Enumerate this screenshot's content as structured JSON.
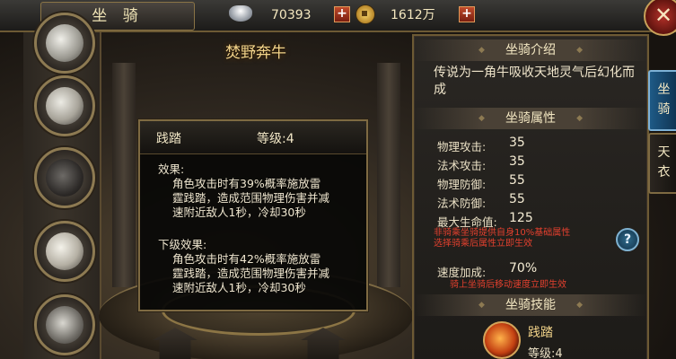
{
  "top_bar": {
    "title": "坐 骑",
    "silver_amount": "70393",
    "gold_amount": "1612万",
    "silver_icon": "silver-ingot-icon",
    "gold_icon": "coin-icon",
    "close_icon": "close-icon"
  },
  "mount": {
    "name": "焚野奔牛"
  },
  "tooltip": {
    "skill_name": "践踏",
    "level": "等级:4",
    "effect_label": "效果:",
    "effect_lines": [
      "角色攻击时有39%概率施放雷",
      "霆践踏，造成范围物理伤害并减",
      "速附近敌人1秒，冷却30秒"
    ],
    "next_label": "下级效果:",
    "next_lines": [
      "角色攻击时有42%概率施放雷",
      "霆践踏，造成范围物理伤害并减",
      "速附近敌人1秒，冷却30秒"
    ]
  },
  "right_panel": {
    "intro_title": "坐骑介绍",
    "intro_text": "传说为一角牛吸收天地灵气后幻化而成",
    "attr_title": "坐骑属性",
    "stats": [
      {
        "label": "物理攻击:",
        "value": "35"
      },
      {
        "label": "法术攻击:",
        "value": "35"
      },
      {
        "label": "物理防御:",
        "value": "55"
      },
      {
        "label": "法术防御:",
        "value": "55"
      },
      {
        "label": "最大生命值:",
        "value": "125"
      }
    ],
    "note1_lines": [
      "非骑乘坐骑提供自身10%基础属性",
      "选择骑乘后属性立即生效"
    ],
    "speed_label": "速度加成:",
    "speed_value": "70%",
    "note2": "骑上坐骑后移动速度立即生效",
    "skills_title": "坐骑技能",
    "skill_name": "践踏",
    "skill_level": "等级:4",
    "help_icon": "question-icon"
  },
  "tabs": {
    "mount_tab": "坐骑",
    "outfit_tab": "天衣"
  }
}
